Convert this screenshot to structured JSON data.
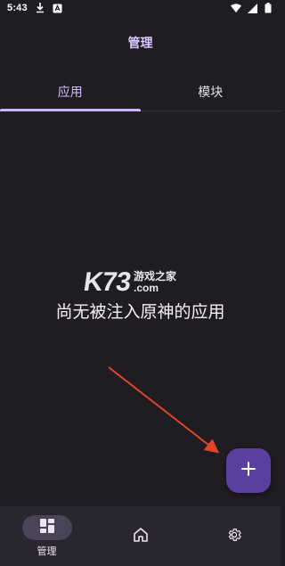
{
  "status_bar": {
    "time": "5:43",
    "icons": [
      "download-icon",
      "app-notification-icon",
      "wifi-icon",
      "signal-icon",
      "battery-icon"
    ]
  },
  "header": {
    "title": "管理"
  },
  "tabs": [
    {
      "label": "应用",
      "active": true
    },
    {
      "label": "模块",
      "active": false
    }
  ],
  "watermark": {
    "logo": "K73",
    "line1": "游戏之家",
    "line2": ".com"
  },
  "empty_state": {
    "message": "尚无被注入原神的应用"
  },
  "fab": {
    "icon": "plus-icon"
  },
  "bottom_nav": [
    {
      "label": "管理",
      "icon": "dashboard-icon",
      "active": true
    },
    {
      "label": "",
      "icon": "home-icon",
      "active": false
    },
    {
      "label": "",
      "icon": "settings-icon",
      "active": false
    }
  ],
  "colors": {
    "background": "#1f1c22",
    "accent": "#c8b6ff",
    "fab": "#5a3f9e",
    "nav_bar": "#2a2630",
    "arrow": "#e0452b"
  }
}
